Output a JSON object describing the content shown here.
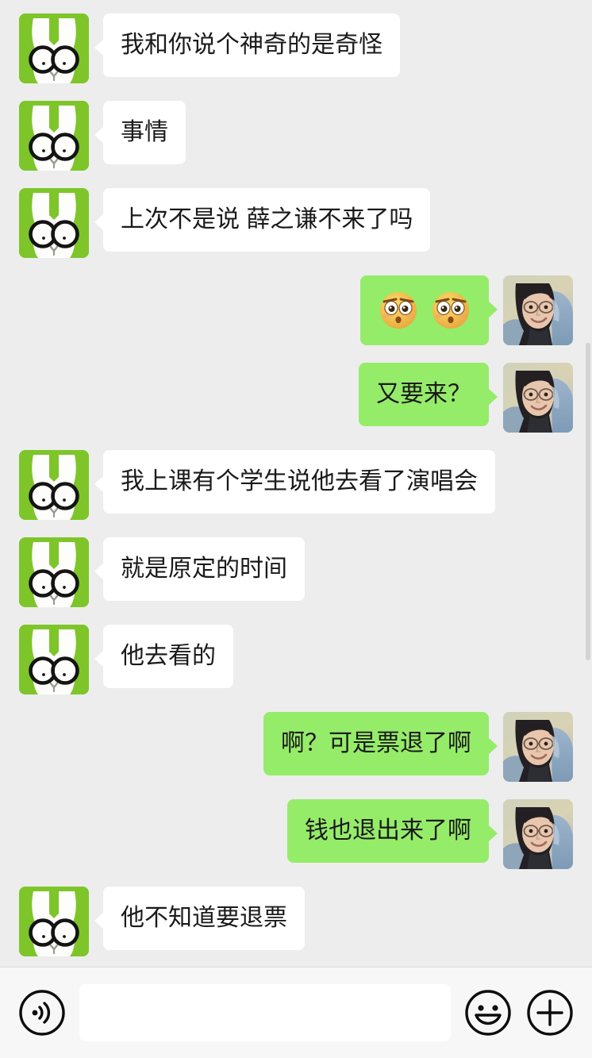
{
  "app": {
    "name": "WeChat Chat",
    "background_color": "#ededed",
    "outgoing_bubble_color": "#95ec69",
    "incoming_bubble_color": "#ffffff",
    "text_color": "#1a1a1a"
  },
  "conversation": {
    "messages": [
      {
        "side": "in",
        "type": "text",
        "text": "我和你说个神奇的是奇怪",
        "avatar": "rabbit-avatar"
      },
      {
        "side": "in",
        "type": "text",
        "text": "事情",
        "avatar": "rabbit-avatar"
      },
      {
        "side": "in",
        "type": "text",
        "text": "上次不是说 薛之谦不来了吗",
        "avatar": "rabbit-avatar"
      },
      {
        "side": "out",
        "type": "emoji",
        "text": "",
        "emoji_count": 2,
        "emoji_name": "shocked-face-emoji",
        "avatar": "photo-avatar"
      },
      {
        "side": "out",
        "type": "text",
        "text": "又要来？",
        "avatar": "photo-avatar"
      },
      {
        "side": "in",
        "type": "text",
        "text": "我上课有个学生说他去看了演唱会",
        "avatar": "rabbit-avatar"
      },
      {
        "side": "in",
        "type": "text",
        "text": "就是原定的时间",
        "avatar": "rabbit-avatar"
      },
      {
        "side": "in",
        "type": "text",
        "text": "他去看的",
        "avatar": "rabbit-avatar"
      },
      {
        "side": "out",
        "type": "text",
        "text": "啊？可是票退了啊",
        "avatar": "photo-avatar"
      },
      {
        "side": "out",
        "type": "text",
        "text": "钱也退出来了啊",
        "avatar": "photo-avatar"
      },
      {
        "side": "in",
        "type": "text",
        "text": "他不知道要退票",
        "avatar": "rabbit-avatar"
      }
    ]
  },
  "input_bar": {
    "voice_icon": "voice-message-icon",
    "emoji_icon": "smiley-face-icon",
    "more_icon": "plus-circle-icon",
    "input_value": "",
    "input_placeholder": ""
  },
  "scrollbar": {
    "visible": true,
    "color": "#c9c9c9"
  }
}
